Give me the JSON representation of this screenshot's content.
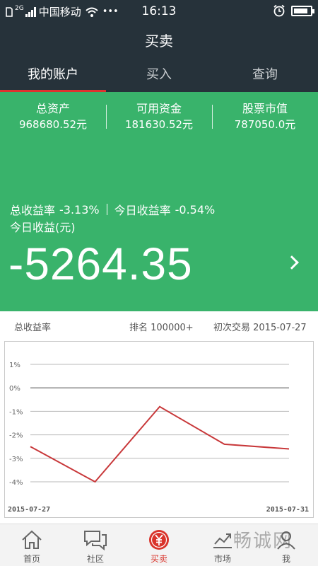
{
  "status_bar": {
    "network_type": "2G",
    "carrier": "中国移动",
    "wifi_icon": "wifi-icon",
    "more_dots": "•••",
    "time": "16:13",
    "alarm_icon": "alarm-icon",
    "battery_level": 0.85
  },
  "header": {
    "title": "买卖"
  },
  "tabs": [
    {
      "label": "我的账户",
      "active": true
    },
    {
      "label": "买入",
      "active": false
    },
    {
      "label": "查询",
      "active": false
    }
  ],
  "assets": [
    {
      "label": "总资产",
      "value": "968680.52元"
    },
    {
      "label": "可用资金",
      "value": "181630.52元"
    },
    {
      "label": "股票市值",
      "value": "787050.0元"
    }
  ],
  "rates": {
    "total_label": "总收益率",
    "total_value": "-3.13%",
    "today_label": "今日收益率",
    "today_value": "-0.54%"
  },
  "today_profit": {
    "label": "今日收益(元)",
    "value": "-5264.35"
  },
  "info": {
    "left": "总收益率",
    "rank": "排名 100000+",
    "first_trade": "初次交易 2015-07-27"
  },
  "colors": {
    "dark": "#26323a",
    "green": "#39b36b",
    "accent_red": "#e0322f",
    "line_red": "#c8383a"
  },
  "chart_data": {
    "type": "line",
    "x": [
      "2015-07-27",
      "2015-07-28",
      "2015-07-29",
      "2015-07-30",
      "2015-07-31"
    ],
    "series": [
      {
        "values": [
          -2.5,
          -4.0,
          -0.8,
          -2.4,
          -2.6
        ]
      }
    ],
    "y_ticks": [
      "1%",
      "0%",
      "-1%",
      "-2%",
      "-3%",
      "-4%"
    ],
    "ylim": [
      -4,
      1
    ],
    "x_start_label": "2015-07-27",
    "x_end_label": "2015-07-31",
    "grid": true
  },
  "tabbar": [
    {
      "label": "首页",
      "icon": "home-icon",
      "active": false
    },
    {
      "label": "社区",
      "icon": "chat-icon",
      "active": false
    },
    {
      "label": "买卖",
      "icon": "yuan-icon",
      "active": true
    },
    {
      "label": "市场",
      "icon": "trend-icon",
      "active": false
    },
    {
      "label": "我",
      "icon": "user-icon",
      "active": false
    }
  ],
  "watermark": "畅诚网"
}
